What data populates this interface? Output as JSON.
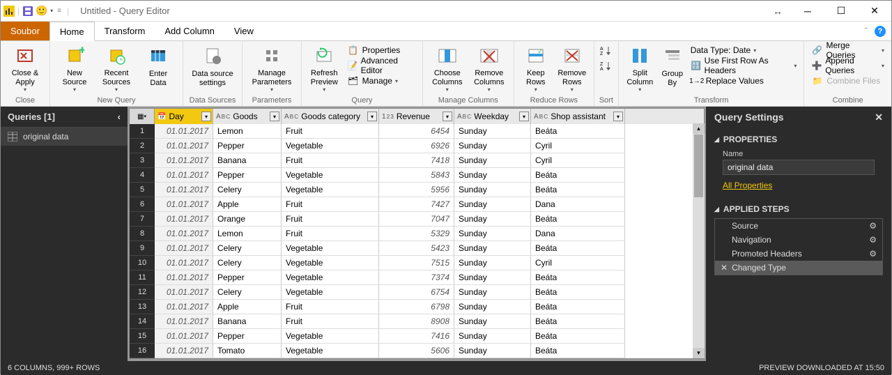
{
  "title": "Untitled - Query Editor",
  "menubar": {
    "file": "Soubor",
    "home": "Home",
    "transform": "Transform",
    "addcol": "Add Column",
    "view": "View"
  },
  "ribbon": {
    "close_apply": "Close &\nApply",
    "close_group": "Close",
    "new_source": "New\nSource",
    "recent_sources": "Recent\nSources",
    "enter_data": "Enter\nData",
    "newquery_group": "New Query",
    "ds_settings": "Data source\nsettings",
    "ds_group": "Data Sources",
    "manage_params": "Manage\nParameters",
    "params_group": "Parameters",
    "refresh": "Refresh\nPreview",
    "properties": "Properties",
    "adv_editor": "Advanced Editor",
    "manage": "Manage",
    "query_group": "Query",
    "choose_cols": "Choose\nColumns",
    "remove_cols": "Remove\nColumns",
    "manage_cols_group": "Manage Columns",
    "keep_rows": "Keep\nRows",
    "remove_rows": "Remove\nRows",
    "reduce_rows_group": "Reduce Rows",
    "sort_group": "Sort",
    "split_col": "Split\nColumn",
    "group_by": "Group\nBy",
    "data_type": "Data Type: Date",
    "first_row": "Use First Row As Headers",
    "replace_vals": "Replace Values",
    "transform_group": "Transform",
    "merge_q": "Merge Queries",
    "append_q": "Append Queries",
    "combine_files": "Combine Files",
    "combine_group": "Combine"
  },
  "queries": {
    "header": "Queries [1]",
    "item1": "original data"
  },
  "columns": {
    "day": "Day",
    "goods": "Goods",
    "category": "Goods category",
    "revenue": "Revenue",
    "weekday": "Weekday",
    "assistant": "Shop assistant"
  },
  "widths": {
    "day": 84,
    "goods": 98,
    "category": 140,
    "revenue": 108,
    "weekday": 110,
    "assistant": 135
  },
  "rows": [
    {
      "n": "1",
      "day": "01.01.2017",
      "goods": "Lemon",
      "category": "Fruit",
      "revenue": "6454",
      "weekday": "Sunday",
      "assistant": "Beáta"
    },
    {
      "n": "2",
      "day": "01.01.2017",
      "goods": "Pepper",
      "category": "Vegetable",
      "revenue": "6926",
      "weekday": "Sunday",
      "assistant": "Cyril"
    },
    {
      "n": "3",
      "day": "01.01.2017",
      "goods": "Banana",
      "category": "Fruit",
      "revenue": "7418",
      "weekday": "Sunday",
      "assistant": "Cyril"
    },
    {
      "n": "4",
      "day": "01.01.2017",
      "goods": "Pepper",
      "category": "Vegetable",
      "revenue": "5843",
      "weekday": "Sunday",
      "assistant": "Beáta"
    },
    {
      "n": "5",
      "day": "01.01.2017",
      "goods": "Celery",
      "category": "Vegetable",
      "revenue": "5956",
      "weekday": "Sunday",
      "assistant": "Beáta"
    },
    {
      "n": "6",
      "day": "01.01.2017",
      "goods": "Apple",
      "category": "Fruit",
      "revenue": "7427",
      "weekday": "Sunday",
      "assistant": "Dana"
    },
    {
      "n": "7",
      "day": "01.01.2017",
      "goods": "Orange",
      "category": "Fruit",
      "revenue": "7047",
      "weekday": "Sunday",
      "assistant": "Beáta"
    },
    {
      "n": "8",
      "day": "01.01.2017",
      "goods": "Lemon",
      "category": "Fruit",
      "revenue": "5329",
      "weekday": "Sunday",
      "assistant": "Dana"
    },
    {
      "n": "9",
      "day": "01.01.2017",
      "goods": "Celery",
      "category": "Vegetable",
      "revenue": "5423",
      "weekday": "Sunday",
      "assistant": "Beáta"
    },
    {
      "n": "10",
      "day": "01.01.2017",
      "goods": "Celery",
      "category": "Vegetable",
      "revenue": "7515",
      "weekday": "Sunday",
      "assistant": "Cyril"
    },
    {
      "n": "11",
      "day": "01.01.2017",
      "goods": "Pepper",
      "category": "Vegetable",
      "revenue": "7374",
      "weekday": "Sunday",
      "assistant": "Beáta"
    },
    {
      "n": "12",
      "day": "01.01.2017",
      "goods": "Celery",
      "category": "Vegetable",
      "revenue": "6754",
      "weekday": "Sunday",
      "assistant": "Beáta"
    },
    {
      "n": "13",
      "day": "01.01.2017",
      "goods": "Apple",
      "category": "Fruit",
      "revenue": "6798",
      "weekday": "Sunday",
      "assistant": "Beáta"
    },
    {
      "n": "14",
      "day": "01.01.2017",
      "goods": "Banana",
      "category": "Fruit",
      "revenue": "8908",
      "weekday": "Sunday",
      "assistant": "Beáta"
    },
    {
      "n": "15",
      "day": "01.01.2017",
      "goods": "Pepper",
      "category": "Vegetable",
      "revenue": "7416",
      "weekday": "Sunday",
      "assistant": "Beáta"
    },
    {
      "n": "16",
      "day": "01.01.2017",
      "goods": "Tomato",
      "category": "Vegetable",
      "revenue": "5606",
      "weekday": "Sunday",
      "assistant": "Beáta"
    }
  ],
  "settings": {
    "header": "Query Settings",
    "properties": "PROPERTIES",
    "name_label": "Name",
    "name_value": "original data",
    "all_props": "All Properties",
    "applied_steps": "APPLIED STEPS",
    "steps": [
      {
        "label": "Source",
        "gear": true
      },
      {
        "label": "Navigation",
        "gear": true
      },
      {
        "label": "Promoted Headers",
        "gear": true
      },
      {
        "label": "Changed Type",
        "gear": false
      }
    ]
  },
  "status": {
    "left": "6 COLUMNS, 999+ ROWS",
    "right": "PREVIEW DOWNLOADED AT 15:50"
  }
}
